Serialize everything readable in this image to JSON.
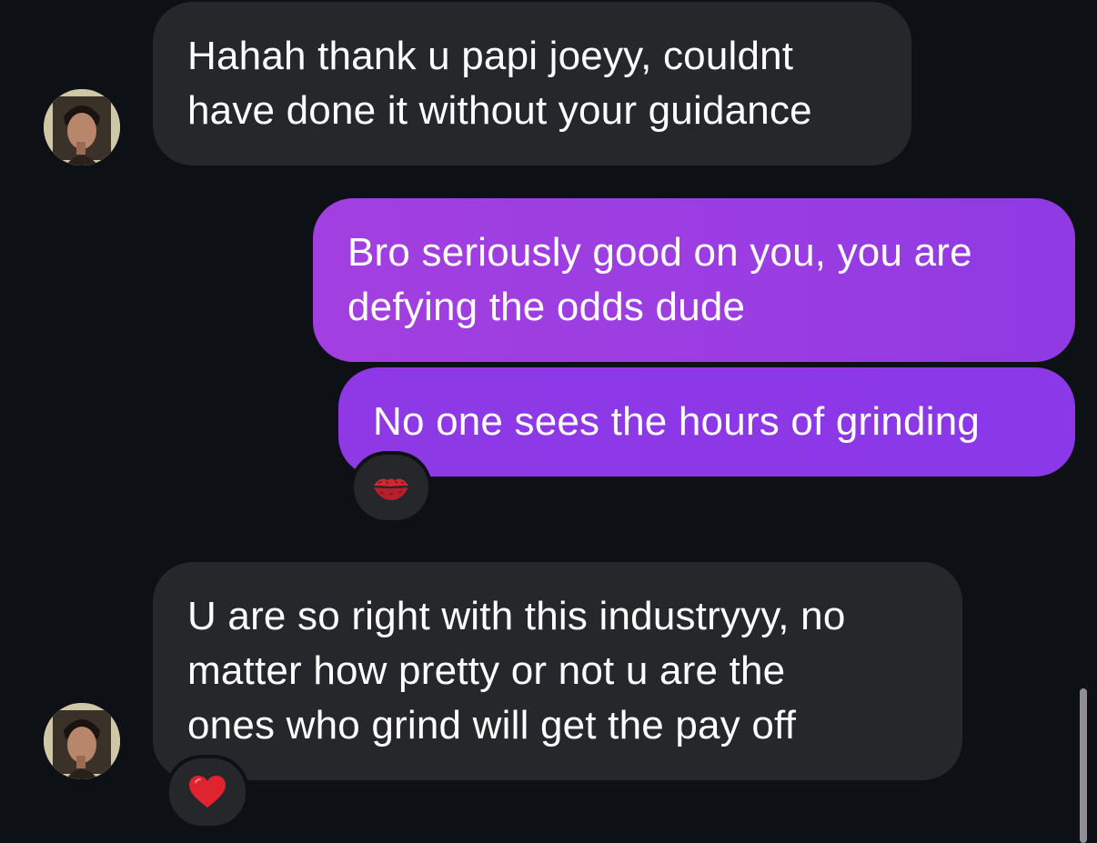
{
  "messages": [
    {
      "direction": "incoming",
      "lines": [
        "Hahah thank u papi joeyy, couldnt",
        "have done it without your guidance"
      ]
    },
    {
      "direction": "outgoing",
      "lines": [
        "Bro seriously good on you, you are",
        "defying the odds dude"
      ]
    },
    {
      "direction": "outgoing",
      "lines": [
        "No one sees the hours of grinding"
      ],
      "reaction": "kiss-mark-icon"
    },
    {
      "direction": "incoming",
      "lines": [
        "U are so right with this industryyy, no",
        "matter how pretty or not u are the",
        "ones who grind will get the pay off"
      ],
      "reaction": "red-heart-icon"
    }
  ],
  "colors": {
    "background": "#0d1014",
    "incoming_bubble": "#25272b",
    "outgoing_bubble_start": "#a23fe0",
    "outgoing_bubble_end": "#8a38e8",
    "text": "#ffffff"
  }
}
